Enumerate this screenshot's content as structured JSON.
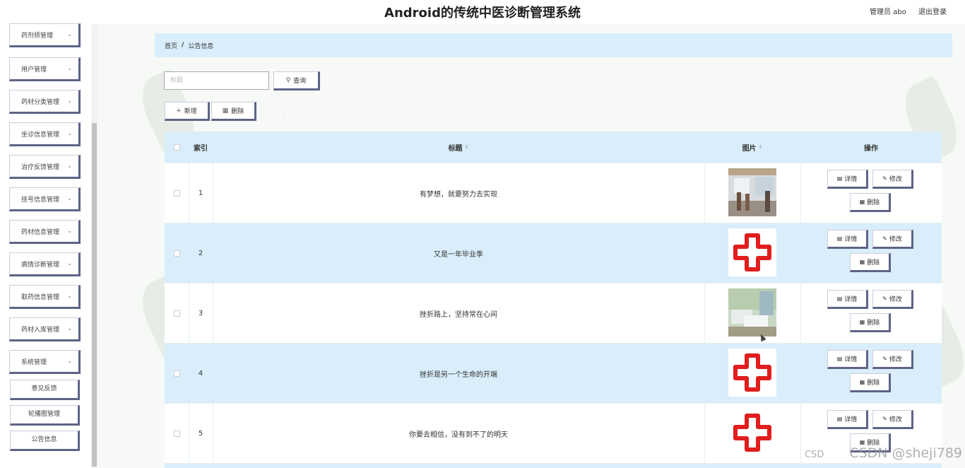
{
  "header": {
    "title": "Android的传统中医诊断管理系统",
    "user_label": "管理员 abo",
    "logout_label": "退出登录"
  },
  "sidebar": {
    "items": [
      {
        "label": "药剂师管理"
      },
      {
        "label": "用户管理"
      },
      {
        "label": "药材分类管理"
      },
      {
        "label": "坐诊信息管理"
      },
      {
        "label": "治疗反馈管理"
      },
      {
        "label": "挂号信息管理"
      },
      {
        "label": "药材信息管理"
      },
      {
        "label": "病情诊断管理"
      },
      {
        "label": "取药信息管理"
      },
      {
        "label": "药材入库管理"
      },
      {
        "label": "系统管理"
      }
    ],
    "sub_items": [
      {
        "label": "意见反馈"
      },
      {
        "label": "轮播图管理"
      },
      {
        "label": "公告信息"
      }
    ]
  },
  "breadcrumb": {
    "home": "首页",
    "separator": "/",
    "current": "公告信息"
  },
  "search": {
    "placeholder": "标题",
    "query_label": "查询"
  },
  "actions": {
    "add_label": "新增",
    "delete_label": "删除"
  },
  "table": {
    "headers": {
      "index": "索引",
      "title": "标题",
      "image": "图片",
      "operation": "操作"
    },
    "rows": [
      {
        "index": "1",
        "title": "有梦想，就要努力去实现",
        "image": "hospital-hall-photo"
      },
      {
        "index": "2",
        "title": "又是一年毕业季",
        "image": "red-cross-icon"
      },
      {
        "index": "3",
        "title": "挫折路上，坚持常在心间",
        "image": "hospital-ward-photo"
      },
      {
        "index": "4",
        "title": "挫折是另一个生命的开端",
        "image": "red-cross-icon"
      },
      {
        "index": "5",
        "title": "你要去相信，没有到不了的明天",
        "image": "red-cross-icon"
      }
    ],
    "row_buttons": {
      "detail": "详情",
      "edit": "修改",
      "delete": "删除"
    }
  },
  "watermark": {
    "small": "CSD",
    "text": "CSDN @sheji789"
  },
  "colors": {
    "accent_border": "#5e6387",
    "header_bg": "#d9eefa",
    "cross_red": "#e11d1d"
  }
}
